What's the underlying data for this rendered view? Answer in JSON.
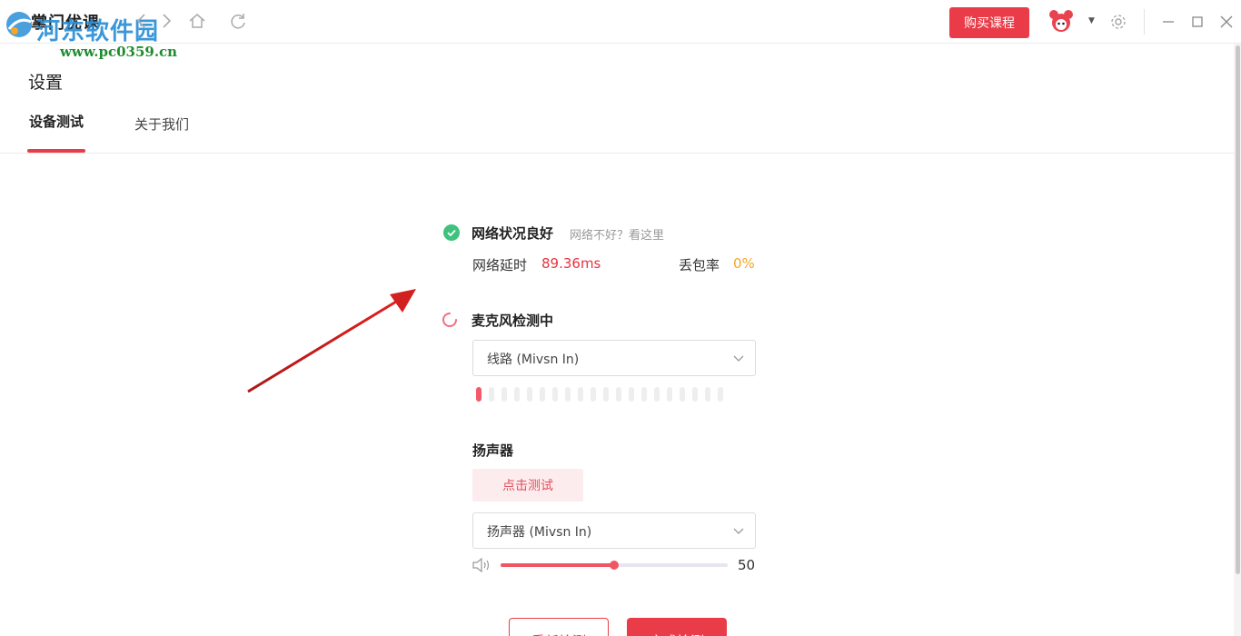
{
  "app": {
    "title": "掌门优课"
  },
  "watermark": {
    "name": "河东软件园",
    "url": "www.pc0359.cn"
  },
  "header": {
    "buy_label": "购买课程"
  },
  "settings": {
    "title": "设置",
    "tabs": [
      {
        "label": "设备测试",
        "active": true
      },
      {
        "label": "关于我们",
        "active": false
      }
    ]
  },
  "network": {
    "status": "网络状况良好",
    "help_link": "网络不好？看这里",
    "latency_label": "网络延时",
    "latency_value": "89.36ms",
    "loss_label": "丢包率",
    "loss_value": "0%"
  },
  "microphone": {
    "status": "麦克风检测中",
    "device": "线路 (Mivsn In)",
    "level_bars_total": 20,
    "level_bars_active": 1
  },
  "speaker": {
    "title": "扬声器",
    "test_label": "点击测试",
    "device": "扬声器 (Mivsn In)",
    "volume": 50,
    "volume_max": 100
  },
  "actions": {
    "redo_label": "重新检测",
    "done_label": "完成检测"
  },
  "colors": {
    "accent": "#ea3c48",
    "success": "#3ec27d",
    "latency": "#e8333f",
    "loss": "#f5a623",
    "annotation_arrow": "#d21f1f"
  },
  "icons": {
    "nav": [
      "back-icon",
      "forward-icon",
      "home-icon",
      "refresh-icon"
    ],
    "window": [
      "minimize-icon",
      "maximize-icon",
      "close-icon"
    ]
  }
}
